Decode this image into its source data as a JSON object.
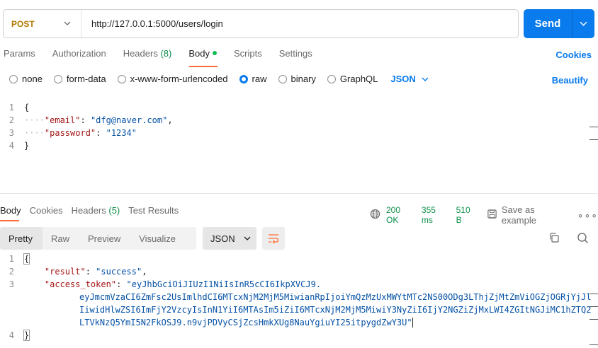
{
  "request": {
    "method": "POST",
    "url": "http://127.0.0.1:5000/users/login",
    "send_label": "Send"
  },
  "request_tabs": {
    "params": "Params",
    "authorization": "Authorization",
    "headers": "Headers",
    "headers_count": "(8)",
    "body": "Body",
    "scripts": "Scripts",
    "settings": "Settings",
    "cookies": "Cookies"
  },
  "body_types": {
    "none": "none",
    "form_data": "form-data",
    "urlencoded": "x-www-form-urlencoded",
    "raw": "raw",
    "binary": "binary",
    "graphql": "GraphQL",
    "selected": "raw",
    "language": "JSON",
    "beautify": "Beautify"
  },
  "request_body": {
    "line_numbers": [
      "1",
      "2",
      "3",
      "4"
    ],
    "open_brace": "{",
    "close_brace": "}",
    "fields": [
      {
        "key": "\"email\"",
        "value": "\"dfg@naver.com\"",
        "trail": ","
      },
      {
        "key": "\"password\"",
        "value": "\"1234\"",
        "trail": ""
      }
    ]
  },
  "response_tabs": {
    "body": "Body",
    "cookies": "Cookies",
    "headers": "Headers",
    "headers_count": "(5)",
    "test_results": "Test Results"
  },
  "response_meta": {
    "status": "200 OK",
    "time": "355 ms",
    "size": "510 B",
    "save": "Save as example",
    "more": "∘∘∘"
  },
  "response_view": {
    "pretty": "Pretty",
    "raw": "Raw",
    "preview": "Preview",
    "visualize": "Visualize",
    "format": "JSON"
  },
  "response_body": {
    "line_numbers": [
      "1",
      "2",
      "3",
      "4"
    ],
    "open_brace": "{",
    "close_brace": "}",
    "result_key": "\"result\"",
    "result_value": "\"success\"",
    "token_key": "\"access_token\"",
    "token_lines": [
      "\"eyJhbGciOiJIUzI1NiIsInR5cCI6IkpXVCJ9.",
      "eyJmcmVzaCI6ZmFsc2UsImlhdCI6MTcxNjM2MjM5MiwianRpIjoiYmQzMzUxMWYtMTc2NS00ODg3LThjZjMtZmViOGZjOGRjYjJl",
      "IiwidHlwZSI6ImFjY2VzcyIsInN1YiI6MTAsIm5iZiI6MTcxNjM2MjM5MiwiY3NyZiI6IjY2NGZiZjMxLWI4ZGItNGJiMC1hZTQ2",
      "LTVkNzQ5YmI5N2FkOSJ9.n9vjPDVyCSjZcsHmkXUg8NauYgiuYI25itpygdZwY3U\""
    ]
  }
}
